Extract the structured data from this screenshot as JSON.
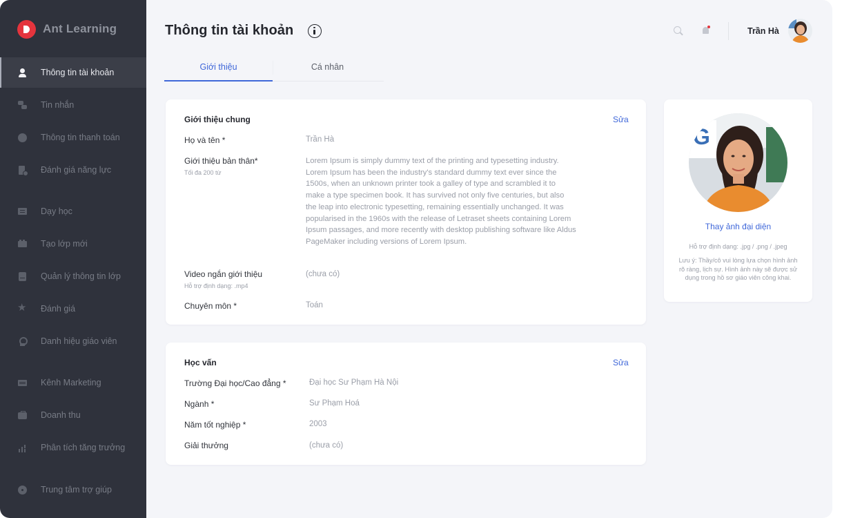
{
  "brand": {
    "name": "Ant Learning",
    "logo_color": "#e5343d"
  },
  "sidebar": {
    "items": [
      {
        "label": "Thông tin tài khoản",
        "icon": "user-icon",
        "active": true
      },
      {
        "label": "Tin nhắn",
        "icon": "message-icon",
        "active": false
      },
      {
        "label": "Thông tin thanh toán",
        "icon": "payment-icon",
        "active": false
      },
      {
        "label": "Đánh giá năng lực",
        "icon": "assessment-icon",
        "active": false
      },
      {
        "label": "Dạy học",
        "icon": "teaching-icon",
        "active": false
      },
      {
        "label": "Tạo lớp mới",
        "icon": "create-class-icon",
        "active": false
      },
      {
        "label": "Quản lý thông tin lớp",
        "icon": "class-list-icon",
        "active": false
      },
      {
        "label": "Đánh giá",
        "icon": "star-icon",
        "active": false
      },
      {
        "label": "Danh hiệu giáo viên",
        "icon": "award-icon",
        "active": false
      },
      {
        "label": "Kênh Marketing",
        "icon": "marketing-icon",
        "active": false
      },
      {
        "label": "Doanh thu",
        "icon": "revenue-icon",
        "active": false
      },
      {
        "label": "Phân tích tăng trưởng",
        "icon": "growth-chart-icon",
        "active": false
      },
      {
        "label": "Trung tâm trợ giúp",
        "icon": "help-icon",
        "active": false
      }
    ]
  },
  "header": {
    "title": "Thông tin tài khoản",
    "user_name": "Trần Hà"
  },
  "tabs": [
    {
      "label": "Giới thiệu",
      "active": true
    },
    {
      "label": "Cá nhân",
      "active": false
    }
  ],
  "intro_card": {
    "title": "Giới thiệu chung",
    "edit": "Sửa",
    "fields": {
      "name_label": "Họ và tên *",
      "name_value": "Trần Hà",
      "bio_label": "Giới thiệu bản thân*",
      "bio_hint": "Tối đa 200 từ",
      "bio_value": "Lorem Ipsum is simply dummy text of the printing and typesetting industry. Lorem Ipsum has been the industry's standard dummy text ever since the 1500s, when an unknown printer took a galley of type and scrambled it to make a type specimen book. It has survived not only five centuries, but also the leap into electronic typesetting, remaining essentially unchanged. It was popularised in the 1960s with the release of Letraset sheets containing Lorem Ipsum passages, and more recently with desktop publishing software like Aldus PageMaker including versions of Lorem Ipsum.",
      "video_label": "Video ngắn giới thiệu",
      "video_hint": "Hỗ trợ định dạng: .mp4",
      "video_value": "(chưa có)",
      "major_label": "Chuyên môn *",
      "major_value": "Toán"
    }
  },
  "education_card": {
    "title": "Học vấn",
    "edit": "Sửa",
    "fields": {
      "school_label": "Trường Đại học/Cao đẳng *",
      "school_value": "Đại học Sư Phạm Hà Nội",
      "field_label": "Ngành *",
      "field_value": "Sư Phạm Hoá",
      "year_label": "Năm tốt nghiệp *",
      "year_value": "2003",
      "award_label": "Giải thưởng",
      "award_value": "(chưa có)"
    }
  },
  "photo_card": {
    "change_label": "Thay ảnh đại diện",
    "format_note": "Hỗ trợ định dạng: .jpg / .png / .jpeg",
    "note": "Lưu ý: Thầy/cô vui lòng lựa chọn hình ảnh rõ ràng, lịch sự. Hình ảnh này sẽ được sử dụng trong hồ sơ giáo viên công khai."
  },
  "colors": {
    "sidebar_bg": "#2f323c",
    "accent": "#3f67d9",
    "page_bg": "#f4f5f9",
    "notification_dot": "#e5343d"
  }
}
